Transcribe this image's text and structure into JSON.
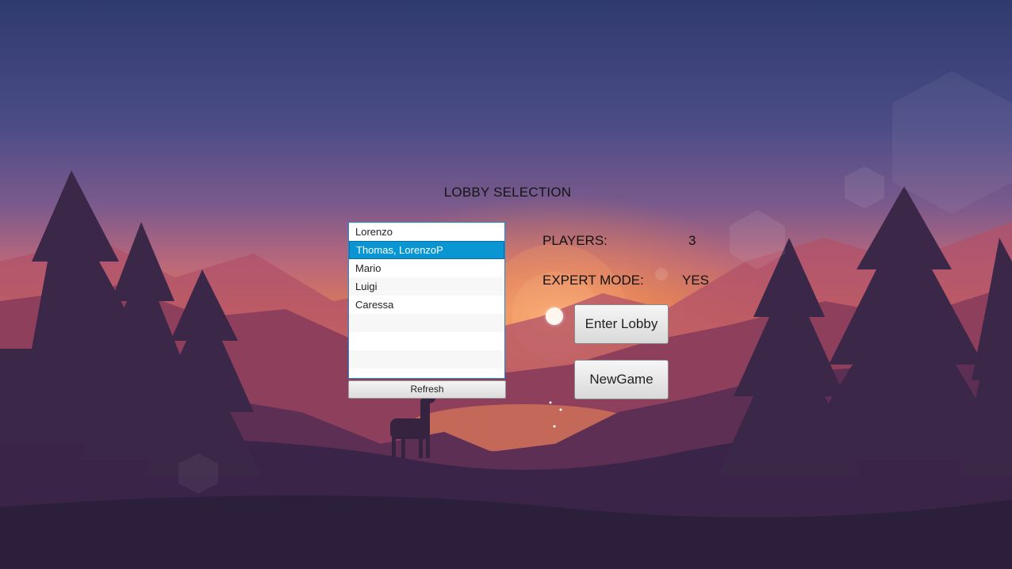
{
  "title": "LOBBY SELECTION",
  "lobbies": [
    "Lorenzo",
    "Thomas, LorenzoP",
    "Mario",
    "Luigi",
    "Caressa"
  ],
  "selected_lobby": "Thomas, LorenzoP",
  "refresh_label": "Refresh",
  "info": {
    "players_label": "PLAYERS:",
    "players_value": "3",
    "expert_label": "EXPERT MODE:",
    "expert_value": "YES"
  },
  "buttons": {
    "enter": "Enter Lobby",
    "new_game": "NewGame"
  },
  "colors": {
    "selection": "#0a96d3",
    "list_border": "#1a8dd0"
  }
}
